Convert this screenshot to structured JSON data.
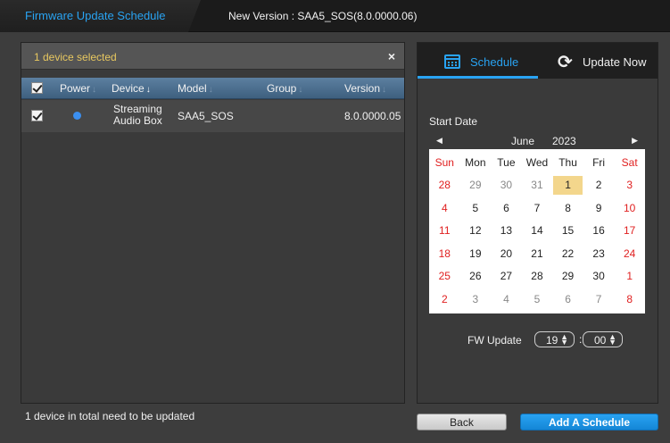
{
  "window": {
    "title": "Firmware Update Schedule",
    "version_text": "New Version : SAA5_SOS(8.0.0000.06)"
  },
  "device_panel": {
    "selected_text": "1 device selected",
    "close_label": "×",
    "columns": [
      "Power",
      "Device",
      "Model",
      "Group",
      "Version"
    ],
    "rows": [
      {
        "checked": true,
        "power": "on",
        "device": "Streaming Audio Box",
        "model": "SAA5_SOS",
        "group": "",
        "version": "8.0.0000.05"
      }
    ],
    "footer_text": "1 device in total need to be updated"
  },
  "tabs": [
    {
      "label": "Schedule",
      "icon": "calendar-icon",
      "active": true
    },
    {
      "label": "Update Now",
      "icon": "refresh-icon",
      "active": false
    }
  ],
  "schedule": {
    "start_date_label": "Start Date",
    "calendar": {
      "month": "June",
      "year": "2023",
      "weekdays": [
        "Sun",
        "Mon",
        "Tue",
        "Wed",
        "Thu",
        "Fri",
        "Sat"
      ],
      "weeks": [
        [
          "28",
          "29",
          "30",
          "31",
          "1",
          "2",
          "3"
        ],
        [
          "4",
          "5",
          "6",
          "7",
          "8",
          "9",
          "10"
        ],
        [
          "11",
          "12",
          "13",
          "14",
          "15",
          "16",
          "17"
        ],
        [
          "18",
          "19",
          "20",
          "21",
          "22",
          "23",
          "24"
        ],
        [
          "25",
          "26",
          "27",
          "28",
          "29",
          "30",
          "1"
        ],
        [
          "2",
          "3",
          "4",
          "5",
          "6",
          "7",
          "8"
        ]
      ],
      "selected_day": "1"
    },
    "fw_update_label": "FW Update",
    "hour": "19",
    "minute": "00",
    "time_separator": ":"
  },
  "buttons": {
    "back": "Back",
    "add_schedule": "Add A Schedule"
  },
  "colors": {
    "accent": "#29a3f2",
    "weekend": "#e02020",
    "selected_day": "#f3d68c",
    "power_on": "#3b8ff0"
  }
}
